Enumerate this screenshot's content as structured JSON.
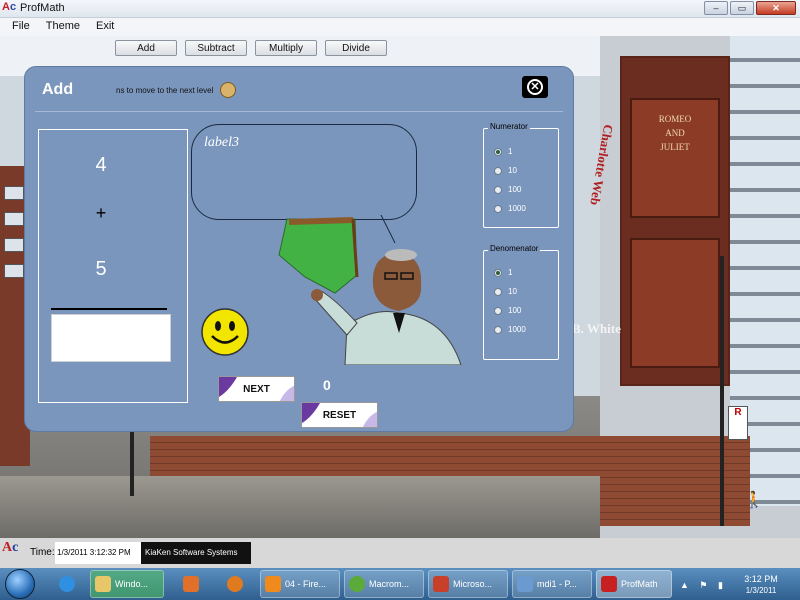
{
  "window": {
    "title": "ProfMath",
    "controls": {
      "minimize": "–",
      "maximize": "▭",
      "close": "✕"
    }
  },
  "menu": [
    "File",
    "Theme",
    "Exit"
  ],
  "operations": [
    "Add",
    "Subtract",
    "Multiply",
    "Divide"
  ],
  "panel": {
    "title": "Add",
    "hint": "ns to move to the next level",
    "close_icon": "close-circle-icon",
    "problem": {
      "first_number": "4",
      "operator": "+",
      "second_number": "5",
      "answer": ""
    },
    "bubble_label": "label3",
    "next_label": "NEXT",
    "reset_label": "RESET",
    "score": "0",
    "numerator": {
      "legend": "Numerator",
      "options": [
        "1",
        "10",
        "100",
        "1000"
      ],
      "selected": "1"
    },
    "denominator": {
      "legend": "Denomenator",
      "options": [
        "1",
        "10",
        "100",
        "1000"
      ],
      "selected": "1"
    }
  },
  "background": {
    "book_titles": [
      "ROMEO",
      "AND",
      "JULIET"
    ],
    "sign_text": "Charlotte Web",
    "author_text": "B. White"
  },
  "status": {
    "time_label": "Time:",
    "time_value": "1/3/2011 3:12:32 PM",
    "company": "KiaKen Software Systems"
  },
  "taskbar": {
    "items": [
      {
        "label": "Windo...",
        "icon": "folder-icon",
        "color": "#3fb23f"
      },
      {
        "label": "",
        "icon": "media-player-icon",
        "color": "#e0702a"
      },
      {
        "label": "",
        "icon": "firefox-icon",
        "color": "#e07a1f"
      },
      {
        "label": "04 - Fire...",
        "icon": "vlc-icon",
        "color": "#f08a1c"
      },
      {
        "label": "Macrom...",
        "icon": "dreamweaver-icon",
        "color": "#5cab3a"
      },
      {
        "label": "Microso...",
        "icon": "powerpoint-icon",
        "color": "#c8402a"
      },
      {
        "label": "mdi1 - P...",
        "icon": "paint-icon",
        "color": "#6a9ad0"
      },
      {
        "label": "ProfMath",
        "icon": "profmath-icon",
        "color": "#c82020"
      }
    ],
    "pinned": [
      {
        "icon": "internet-explorer-icon",
        "color": "#2f8fe0"
      }
    ],
    "clock_time": "3:12 PM",
    "clock_date": "1/3/2011"
  },
  "colors": {
    "panel": "#7b96bd",
    "accent": "#2f5f8f",
    "smiley": "#f2e600"
  }
}
